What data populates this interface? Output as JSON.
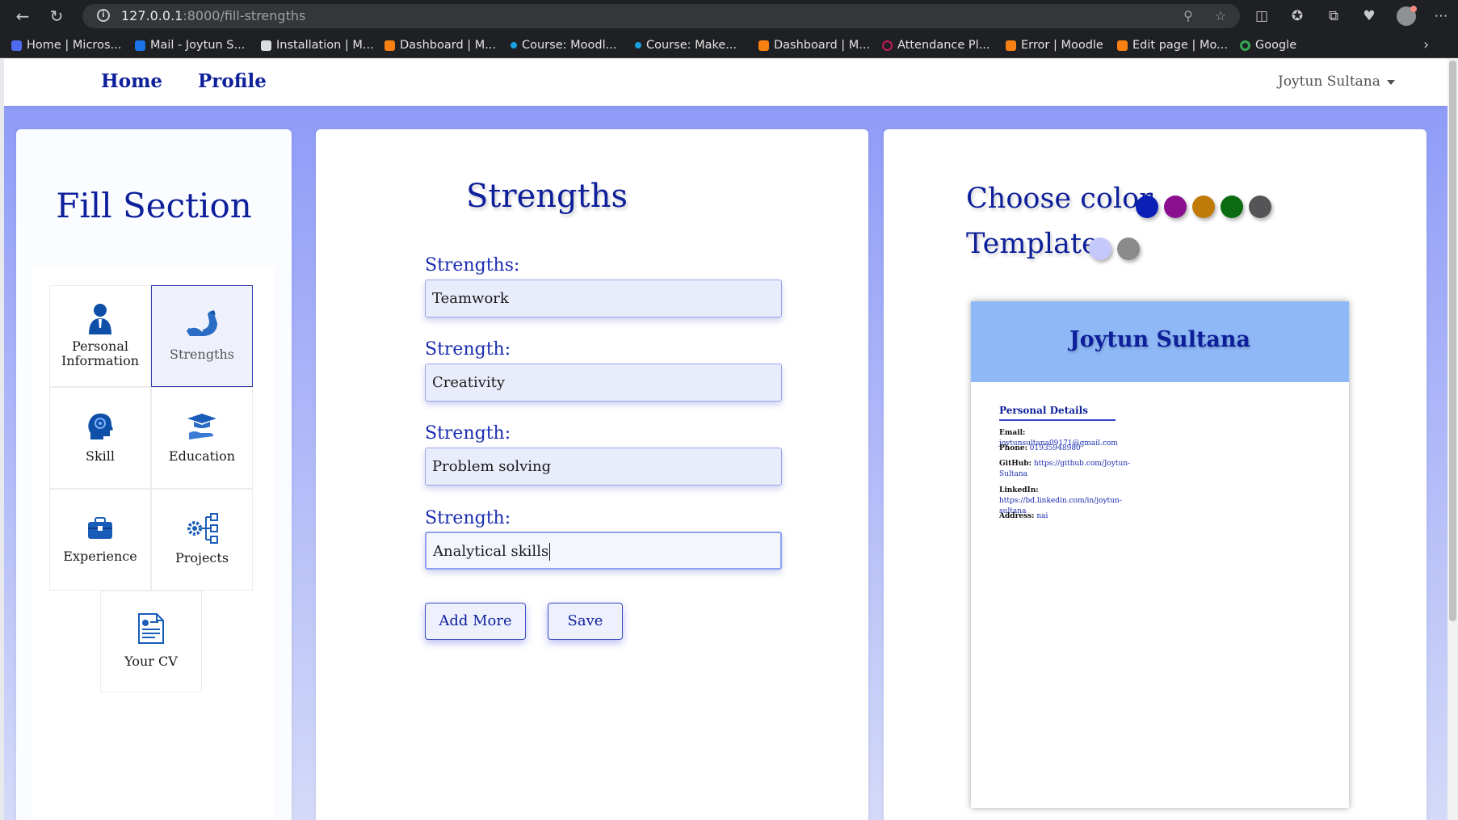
{
  "browser": {
    "url_host": "127.0.0.1",
    "url_rest": ":8000/fill-strengths",
    "bookmarks": [
      {
        "label": "Home | Micros...",
        "color": "#4f6bed"
      },
      {
        "label": "Mail - Joytun S...",
        "color": "#1a73e8"
      },
      {
        "label": "Installation | M...",
        "color": "#dadce0"
      },
      {
        "label": "Dashboard | M...",
        "color": "#f98012"
      },
      {
        "label": "Course: Moodl...",
        "color": "#1a9fe0"
      },
      {
        "label": "Course: Make...",
        "color": "#1a9fe0"
      },
      {
        "label": "Dashboard | M...",
        "color": "#f98012"
      },
      {
        "label": "Attendance Pl...",
        "color": "#c2185b"
      },
      {
        "label": "Error | Moodle",
        "color": "#f98012"
      },
      {
        "label": "Edit page | Mo...",
        "color": "#f98012"
      },
      {
        "label": "Google",
        "color": "#34a853"
      }
    ]
  },
  "nav": {
    "home": "Home",
    "profile": "Profile",
    "user": "Joytun Sultana"
  },
  "sidebar": {
    "title": "Fill Section",
    "items": [
      {
        "label": "Personal Information",
        "icon": "person-icon"
      },
      {
        "label": "Strengths",
        "icon": "flexed-arm-icon",
        "active": true
      },
      {
        "label": "Skill",
        "icon": "brain-head-icon"
      },
      {
        "label": "Education",
        "icon": "graduation-cap-icon"
      },
      {
        "label": "Experience",
        "icon": "briefcase-icon"
      },
      {
        "label": "Projects",
        "icon": "gear-network-icon"
      },
      {
        "label": "Your CV",
        "icon": "document-icon"
      }
    ]
  },
  "form": {
    "title": "Strengths",
    "fields": [
      {
        "label": "Strengths:",
        "value": "Teamwork"
      },
      {
        "label": "Strength:",
        "value": "Creativity"
      },
      {
        "label": "Strength:",
        "value": "Problem solving"
      },
      {
        "label": "Strength:",
        "value": "Analytical skills"
      }
    ],
    "add_more": "Add More",
    "save": "Save"
  },
  "preview": {
    "choose_color_label": "Choose color",
    "template_label": "Template",
    "colors": [
      "#0a1fb5",
      "#8a0f8f",
      "#c07a08",
      "#0a6b10",
      "#555558"
    ],
    "templates": [
      "#c5c8fb",
      "#8a8a8a"
    ],
    "cv": {
      "name": "Joytun Sultana",
      "section_title": "Personal Details",
      "rows": [
        {
          "key": "Email:",
          "value": "joytunsultana09171@gmail.com"
        },
        {
          "key": "Phone:",
          "value": "01935948980"
        },
        {
          "key": "GitHub:",
          "value": "https://github.com/Joytun-Sultana"
        },
        {
          "key": "LinkedIn:",
          "value": "https://bd.linkedin.com/in/joytun-sultana"
        },
        {
          "key": "Address:",
          "value": "nai"
        }
      ]
    }
  }
}
